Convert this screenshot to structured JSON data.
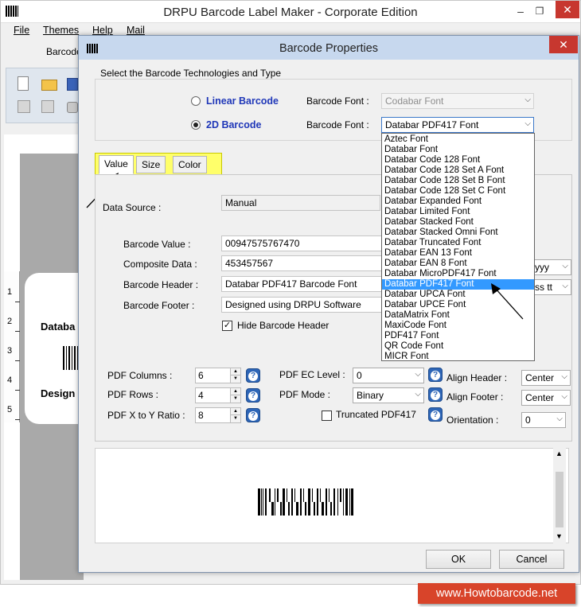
{
  "main_window": {
    "title": "DRPU Barcode Label Maker - Corporate Edition",
    "menu": [
      "File",
      "Themes",
      "Help",
      "Mail"
    ],
    "toolbar_tab_label": "Barcode",
    "canvas_label_line1": "Databa",
    "canvas_label_line2": "Design",
    "ruler_numbers": [
      "1",
      "2",
      "3",
      "4",
      "5"
    ]
  },
  "dialog": {
    "title": "Barcode Properties",
    "tech_group": {
      "legend": "Select the Barcode Technologies and Type",
      "linear_label": "Linear Barcode",
      "twod_label": "2D Barcode",
      "selected": "2D Barcode",
      "font_label_1": "Barcode Font :",
      "font_label_2": "Barcode Font :",
      "linear_font_value": "Codabar Font",
      "twod_font_value": "Databar PDF417 Font"
    },
    "font_options": [
      "Aztec Font",
      "Databar Font",
      "Databar Code 128 Font",
      "Databar Code 128 Set A Font",
      "Databar Code 128 Set B Font",
      "Databar Code 128 Set C Font",
      "Databar Expanded Font",
      "Databar Limited Font",
      "Databar Stacked Font",
      "Databar Stacked Omni Font",
      "Databar Truncated Font",
      "Databar EAN 13 Font",
      "Databar EAN 8 Font",
      "Databar MicroPDF417 Font",
      "Databar PDF417 Font",
      "Databar UPCA Font",
      "Databar UPCE Font",
      "DataMatrix Font",
      "MaxiCode Font",
      "PDF417 Font",
      "QR Code Font",
      "MICR Font"
    ],
    "selected_font": "Databar PDF417 Font",
    "tabs": [
      "Value",
      "Size",
      "Color"
    ],
    "active_tab": "Value",
    "value_tab": {
      "data_source_label": "Data Source :",
      "data_source_value": "Manual",
      "barcode_value_label": "Barcode Value :",
      "barcode_value": "00947575767470",
      "composite_label": "Composite Data :",
      "composite_value": "453457567",
      "header_label": "Barcode Header :",
      "header_value": "Databar PDF417 Barcode Font",
      "footer_label": "Barcode Footer :",
      "footer_value": "Designed using DRPU Software",
      "hide_header_label": "Hide Barcode Header",
      "hide_header_checked": true,
      "date_format_partial": "yyy",
      "time_format_partial": "ss tt"
    },
    "pdf_settings": {
      "columns_label": "PDF Columns :",
      "columns_value": "6",
      "rows_label": "PDF Rows :",
      "rows_value": "4",
      "ratio_label": "PDF X to Y Ratio :",
      "ratio_value": "8",
      "ec_level_label": "PDF EC Level :",
      "ec_level_value": "0",
      "mode_label": "PDF Mode :",
      "mode_value": "Binary",
      "truncated_label": "Truncated PDF417",
      "truncated_checked": false,
      "align_header_label": "Align Header :",
      "align_header_value": "Center",
      "align_footer_label": "Align Footer :",
      "align_footer_value": "Center",
      "orientation_label": "Orientation :",
      "orientation_value": "0"
    },
    "buttons": {
      "ok": "OK",
      "cancel": "Cancel"
    }
  },
  "watermark": "www.Howtobarcode.net",
  "colors": {
    "tab_highlight": "#ffff6a",
    "selection": "#3399ff",
    "watermark_bg": "#d8442a",
    "accent_blue": "#1f37b8"
  }
}
